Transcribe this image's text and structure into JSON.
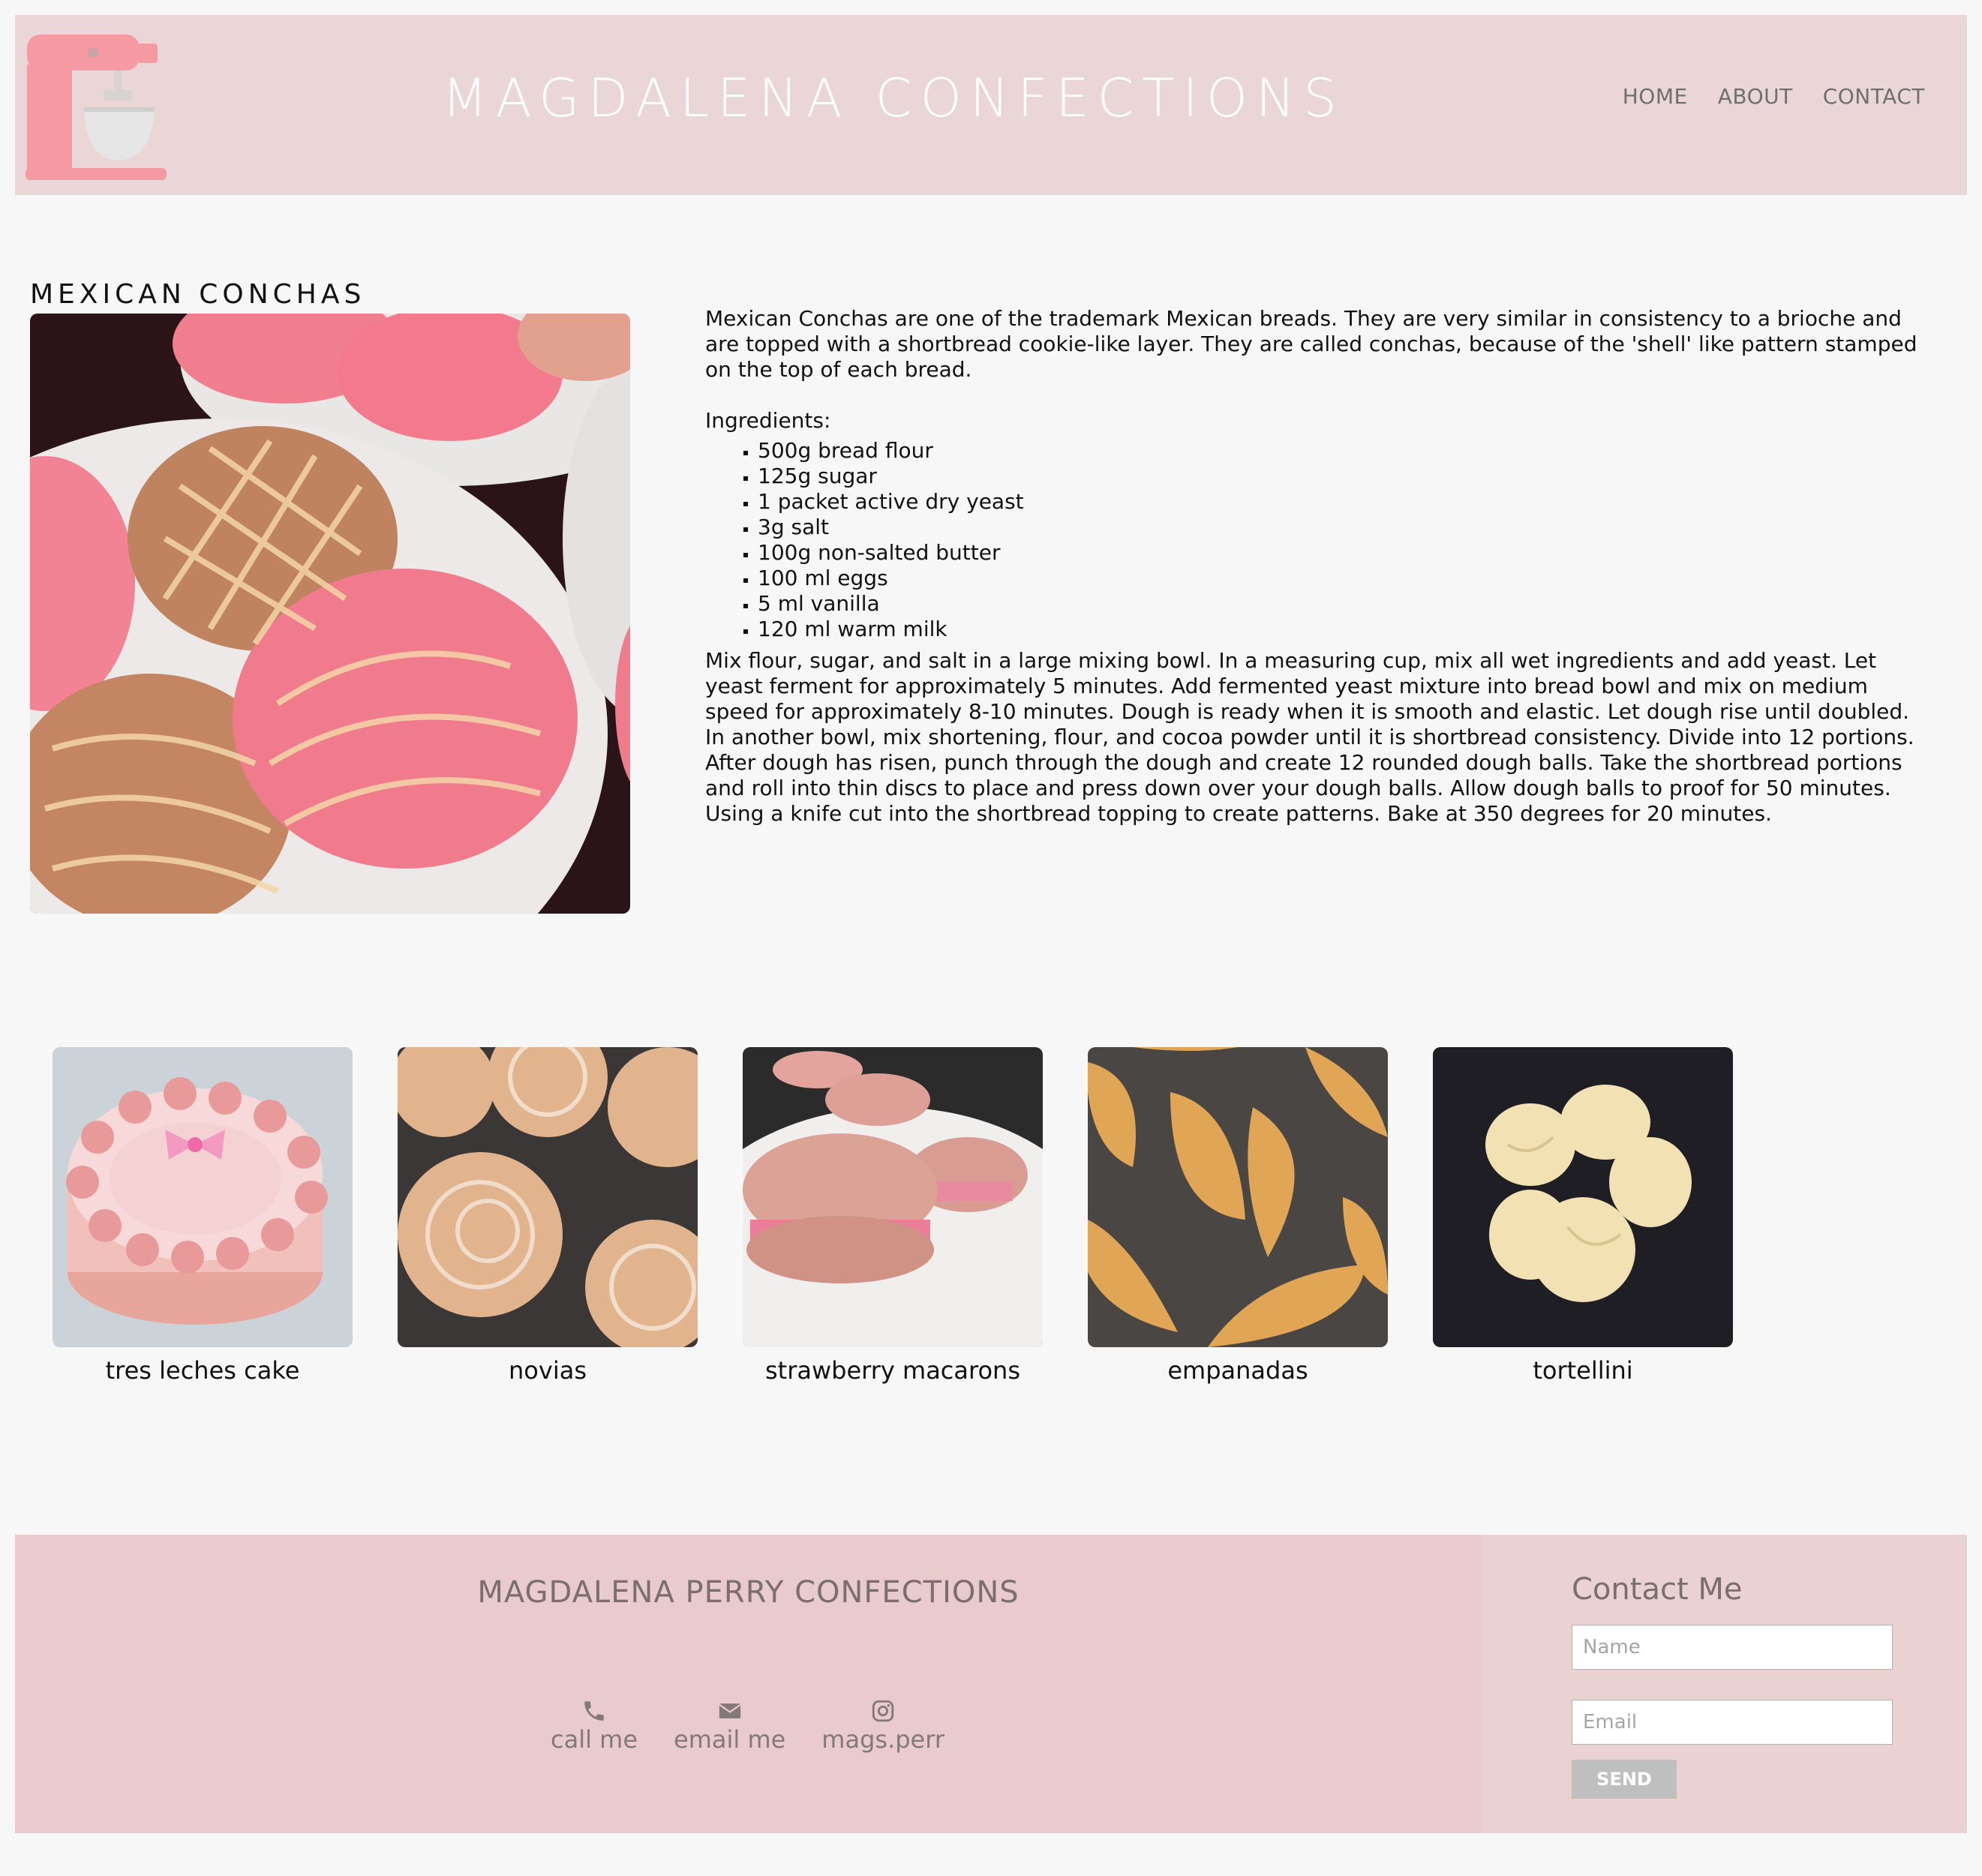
{
  "header": {
    "logo_icon": "stand-mixer-icon",
    "title": "MAGDALENA CONFECTIONS",
    "nav": [
      {
        "label": "HOME"
      },
      {
        "label": "ABOUT"
      },
      {
        "label": "CONTACT"
      }
    ]
  },
  "recipe": {
    "title": "MEXICAN CONCHAS",
    "intro": "Mexican Conchas are one of the trademark Mexican breads. They are very similar in consistency to a brioche and are topped with a shortbread cookie-like layer. They are called conchas, because of the 'shell' like pattern stamped on the top of each bread.",
    "ingredients_label": "Ingredients:",
    "ingredients": [
      "500g bread flour",
      "125g sugar",
      "1 packet active dry yeast",
      "3g salt",
      "100g non-salted butter",
      "100 ml eggs",
      "5 ml vanilla",
      "120 ml warm milk"
    ],
    "instructions": "Mix flour, sugar, and salt in a large mixing bowl. In a measuring cup, mix all wet ingredients and add yeast. Let yeast ferment for approximately 5 minutes. Add fermented yeast mixture into bread bowl and mix on medium speed for approximately 8-10 minutes. Dough is ready when it is smooth and elastic. Let dough rise until doubled. In another bowl, mix shortening, flour, and cocoa powder until it is shortbread consistency. Divide into 12 portions. After dough has risen, punch through the dough and create 12 rounded dough balls. Take the shortbread portions and roll into thin discs to place and press down over your dough balls. Allow dough balls to proof for 50 minutes. Using a knife cut into the shortbread topping to create patterns. Bake at 350 degrees for 20 minutes."
  },
  "gallery": [
    {
      "caption": "tres leches cake"
    },
    {
      "caption": "novias"
    },
    {
      "caption": "strawberry macarons"
    },
    {
      "caption": "empanadas"
    },
    {
      "caption": "tortellini"
    }
  ],
  "footer": {
    "title": "MAGDALENA PERRY CONFECTIONS",
    "links": [
      {
        "icon": "phone-icon",
        "label": "call me"
      },
      {
        "icon": "envelope-icon",
        "label": "email me"
      },
      {
        "icon": "instagram-icon",
        "label": "mags.perr"
      }
    ],
    "contact": {
      "title": "Contact Me",
      "name_placeholder": "Name",
      "email_placeholder": "Email",
      "send_label": "SEND"
    }
  },
  "colors": {
    "header_bg": "#ead6d6",
    "footer_bg": "#e9cbcd",
    "page_bg": "#f8f7f7",
    "accent_pink": "#f2868f"
  }
}
